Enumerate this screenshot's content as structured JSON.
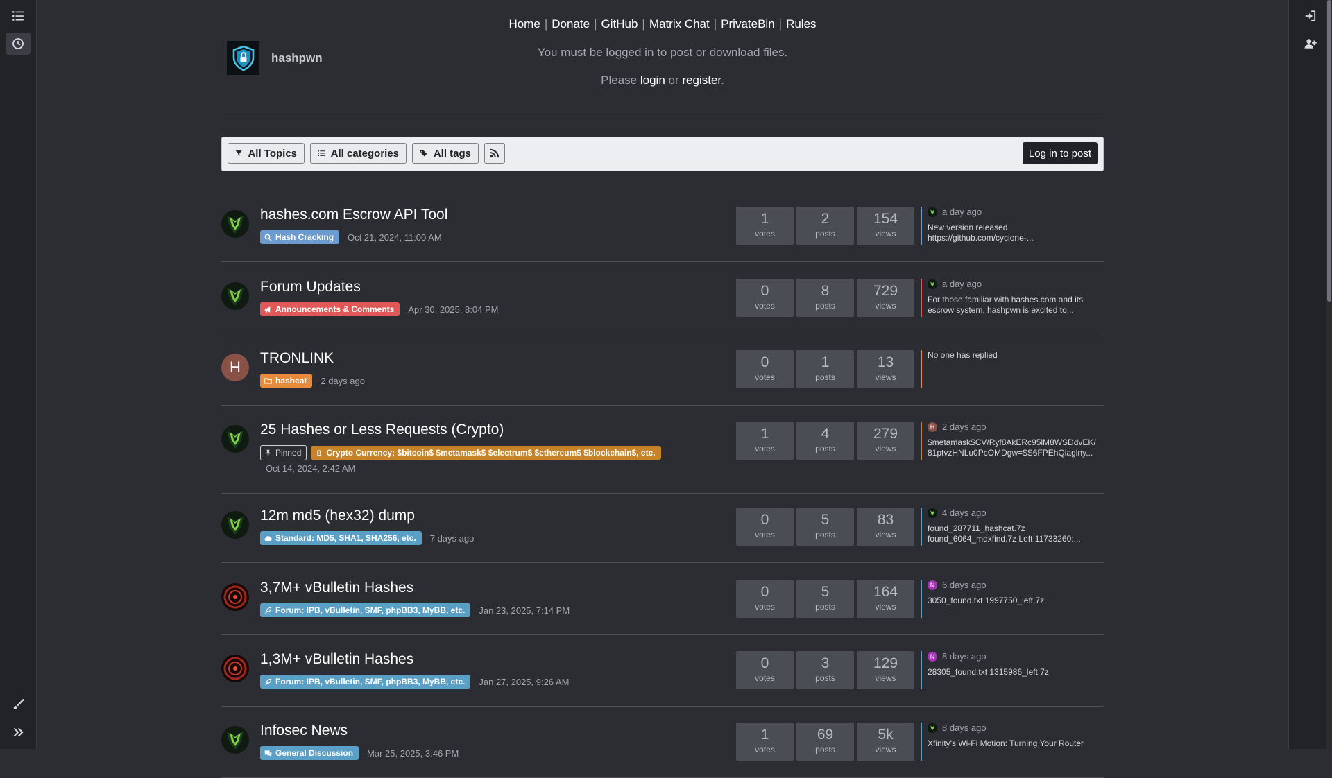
{
  "sidebar_left": {
    "buttons": [
      "topics-list-icon",
      "recent-clock-icon",
      "compose-brush-icon",
      "expand-chevrons-icon"
    ]
  },
  "sidebar_right": {
    "buttons": [
      "login-icon",
      "register-user-plus-icon"
    ]
  },
  "brand": {
    "name": "hashpwn"
  },
  "nav": {
    "links": [
      "Home",
      "Donate",
      "GitHub",
      "Matrix Chat",
      "PrivateBin",
      "Rules"
    ]
  },
  "notice": "You must be logged in to post or download files.",
  "please": {
    "prefix": "Please",
    "login": "login",
    "or": "or",
    "register": "register",
    "suffix": "."
  },
  "toolbar": {
    "all_topics": "All Topics",
    "all_categories": "All categories",
    "all_tags": "All tags",
    "login_to_post": "Log in to post"
  },
  "topics": [
    {
      "title": "hashes.com Escrow API Tool",
      "category": "Hash Cracking",
      "category_color": "#6c9bd0",
      "date": "Oct 21, 2024, 11:00 AM",
      "votes": "1",
      "posts": "2",
      "views": "154",
      "votes_label": "votes",
      "posts_label": "posts",
      "views_label": "views",
      "recent_time": "a day ago",
      "recent_text": "New version released.\nhttps://github.com/cyclone-...",
      "accent": "#6c9bd0"
    },
    {
      "title": "Forum Updates",
      "category": "Announcements & Comments",
      "category_color": "#e25858",
      "date": "Apr 30, 2025, 8:04 PM",
      "votes": "0",
      "posts": "8",
      "views": "729",
      "votes_label": "votes",
      "posts_label": "posts",
      "views_label": "views",
      "recent_time": "a day ago",
      "recent_text": "For those familiar with hashes.com and its\nescrow system, hashpwn is excited to...",
      "accent": "#e25858"
    },
    {
      "title": "TRONLINK",
      "category": "hashcat",
      "category_color": "#e78c3c",
      "date": "2 days ago",
      "avatar_letter": "H",
      "votes": "0",
      "posts": "1",
      "views": "13",
      "votes_label": "votes",
      "posts_label": "posts",
      "views_label": "views",
      "recent_text": "No one has replied",
      "accent": "#e78c3c"
    },
    {
      "title": "25 Hashes or Less Requests (Crypto)",
      "pinned": "Pinned",
      "category": "Crypto Currency: $bitcoin$ $metamask$ $electrum$ $ethereum$ $blockchain$, etc.",
      "category_color": "#c6832a",
      "date": "Oct 14, 2024, 2:42 AM",
      "votes": "1",
      "posts": "4",
      "views": "279",
      "votes_label": "votes",
      "posts_label": "posts",
      "views_label": "views",
      "recent_letter": "H",
      "recent_time": "2 days ago",
      "recent_text": "$metamask$CV/Ryf8AkERc95lM8WSDdvEK/\n81ptvzHNLu0PcOMDgw=$S6FPEhQiaglny...",
      "accent": "#c6832a"
    },
    {
      "title": "12m md5 (hex32) dump",
      "category": "Standard: MD5, SHA1, SHA256, etc.",
      "category_color": "#5a9fc5",
      "date": "7 days ago",
      "votes": "0",
      "posts": "5",
      "views": "83",
      "votes_label": "votes",
      "posts_label": "posts",
      "views_label": "views",
      "recent_time": "4 days ago",
      "recent_text": "found_287711_hashcat.7z\nfound_6064_mdxfind.7z Left 11733260:...",
      "accent": "#5a9fc5"
    },
    {
      "title": "3,7M+ vBulletin Hashes",
      "category": "Forum: IPB, vBulletin, SMF, phpBB3, MyBB, etc.",
      "category_color": "#5a9fc5",
      "date": "Jan 23, 2025, 7:14 PM",
      "votes": "0",
      "posts": "5",
      "views": "164",
      "votes_label": "votes",
      "posts_label": "posts",
      "views_label": "views",
      "recent_letter": "N",
      "recent_time": "6 days ago",
      "recent_text": "3050_found.txt 1997750_left.7z",
      "accent": "#5a9fc5"
    },
    {
      "title": "1,3M+ vBulletin Hashes",
      "category": "Forum: IPB, vBulletin, SMF, phpBB3, MyBB, etc.",
      "category_color": "#5a9fc5",
      "date": "Jan 27, 2025, 9:26 AM",
      "votes": "0",
      "posts": "3",
      "views": "129",
      "votes_label": "votes",
      "posts_label": "posts",
      "views_label": "views",
      "recent_letter": "N",
      "recent_time": "8 days ago",
      "recent_text": "28305_found.txt 1315986_left.7z",
      "accent": "#5a9fc5"
    },
    {
      "title": "Infosec News",
      "category": "General Discussion",
      "category_color": "#5a9fc5",
      "date": "Mar 25, 2025, 3:46 PM",
      "votes": "1",
      "posts": "69",
      "views": "5k",
      "votes_label": "votes",
      "posts_label": "posts",
      "views_label": "views",
      "recent_time": "8 days ago",
      "recent_text": "Xfinity's Wi-Fi Motion: Turning Your Router",
      "accent": "#5a9fc5"
    }
  ]
}
